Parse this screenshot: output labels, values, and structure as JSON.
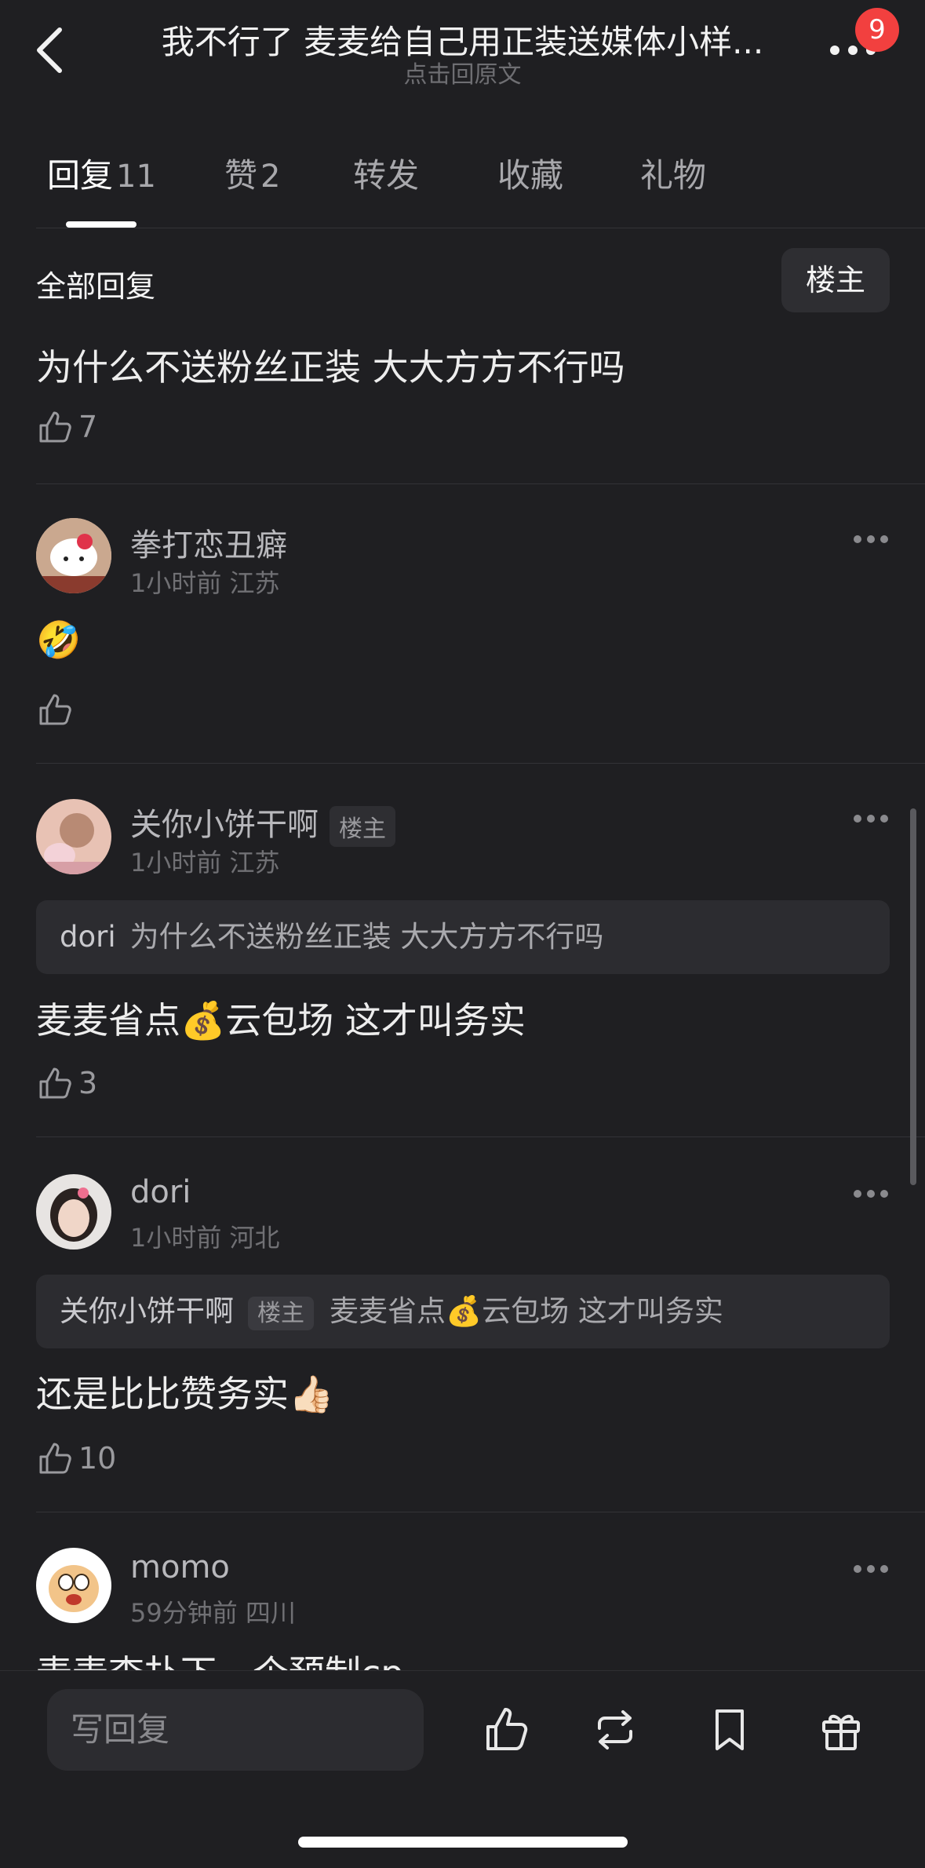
{
  "header": {
    "title": "我不行了 麦麦给自己用正装送媒体小样...",
    "subtitle": "点击回原文",
    "badge_count": "9"
  },
  "tabs": [
    {
      "label": "回复",
      "count": "11",
      "active": true
    },
    {
      "label": "赞",
      "count": "2",
      "active": false
    },
    {
      "label": "转发",
      "count": "",
      "active": false
    },
    {
      "label": "收藏",
      "count": "",
      "active": false
    },
    {
      "label": "礼物",
      "count": "",
      "active": false
    }
  ],
  "section": {
    "title": "全部回复",
    "op_filter_label": "楼主"
  },
  "original_comment": {
    "text": "为什么不送粉丝正装 大大方方不行吗",
    "likes": "7"
  },
  "comments": [
    {
      "username": "拳打恋丑癖",
      "meta": "1小时前 江苏",
      "text": "🤣",
      "likes": ""
    },
    {
      "username": "关你小饼干啊",
      "tag": "楼主",
      "meta": "1小时前 江苏",
      "quote_user": "dori",
      "quote_text": "为什么不送粉丝正装 大大方方不行吗",
      "text": "麦麦省点💰云包场 这才叫务实",
      "likes": "3"
    },
    {
      "username": "dori",
      "meta": "1小时前 河北",
      "quote_user": "关你小饼干啊",
      "quote_tag": "楼主",
      "quote_text": "麦麦省点💰云包场 这才叫务实",
      "text": "还是比比赞务实👍🏻",
      "likes": "10"
    },
    {
      "username": "momo",
      "meta": "59分钟前 四川",
      "text": "麦麦查扑下一个预制cp"
    }
  ],
  "bottom_bar": {
    "reply_placeholder": "写回复"
  },
  "colors": {
    "background": "#1f1f22",
    "badge": "#f2403f",
    "quote_bg": "#2c2c30"
  }
}
